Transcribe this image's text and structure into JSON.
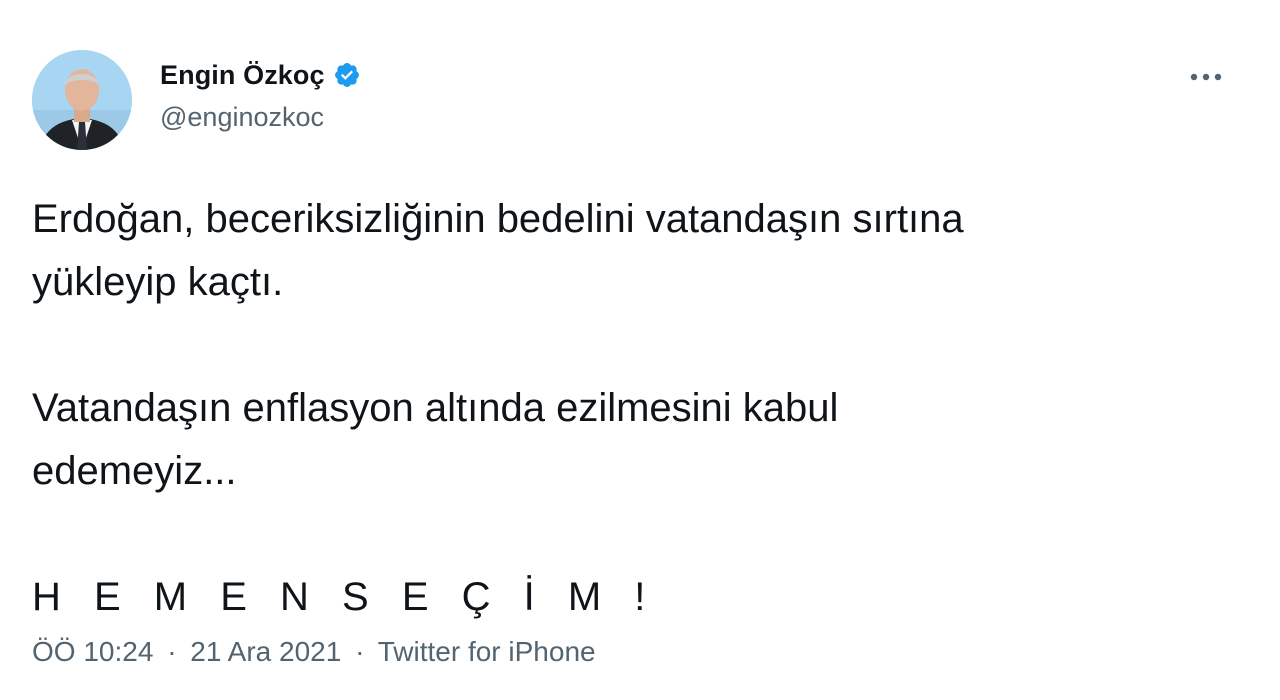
{
  "author": {
    "display_name": "Engin Özkoç",
    "handle": "@enginozkoc",
    "verified_icon": "verified-badge-icon",
    "avatar": "profile-photo"
  },
  "menu": {
    "icon": "more-horizontal-icon",
    "glyph": "···"
  },
  "tweet": {
    "line1": "Erdoğan, beceriksizliğinin bedelini vatandaşın sırtına",
    "line2": "yükleyip kaçtı.",
    "line3": "Vatandaşın enflasyon altında ezilmesini kabul",
    "line4": "edemeyiz...",
    "line5": "H E M E N  S E Ç İ M !"
  },
  "meta": {
    "time": "ÖÖ 10:24",
    "separator": "·",
    "date": "21 Ara 2021",
    "source": "Twitter for iPhone"
  },
  "colors": {
    "verified": "#1d9bf0",
    "text": "#0f1419",
    "secondary": "#536471"
  }
}
